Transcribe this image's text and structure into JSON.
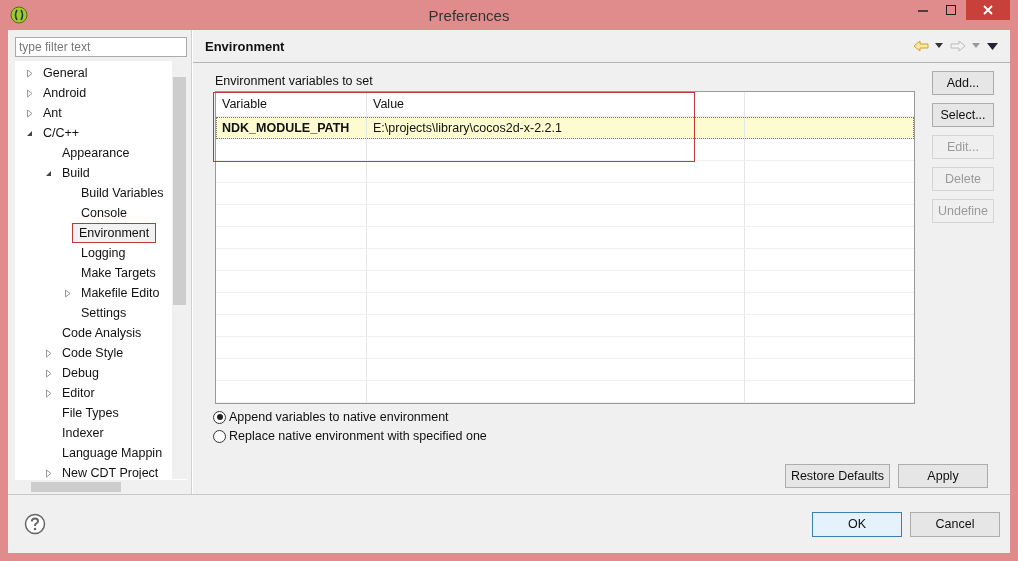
{
  "window": {
    "title": "Preferences"
  },
  "sidebar": {
    "filter": {
      "placeholder": "type filter text"
    },
    "tree": [
      {
        "label": "General",
        "kind": "folder",
        "expanded": false,
        "selected": false
      },
      {
        "label": "Android",
        "kind": "folder",
        "expanded": false,
        "selected": false
      },
      {
        "label": "Ant",
        "kind": "folder",
        "expanded": false,
        "selected": false
      },
      {
        "label": "C/C++",
        "kind": "folder",
        "expanded": true,
        "selected": false,
        "children": [
          {
            "label": "Appearance",
            "kind": "leaf",
            "selected": false
          },
          {
            "label": "Build",
            "kind": "folder",
            "expanded": true,
            "selected": false,
            "children": [
              {
                "label": "Build Variables",
                "kind": "leaf",
                "selected": false
              },
              {
                "label": "Console",
                "kind": "leaf",
                "selected": false
              },
              {
                "label": "Environment",
                "kind": "leaf",
                "selected": true
              },
              {
                "label": "Logging",
                "kind": "leaf",
                "selected": false
              },
              {
                "label": "Make Targets",
                "kind": "leaf",
                "selected": false
              },
              {
                "label": "Makefile Edito",
                "kind": "folder",
                "expanded": false,
                "selected": false
              },
              {
                "label": "Settings",
                "kind": "leaf",
                "selected": false
              }
            ]
          },
          {
            "label": "Code Analysis",
            "kind": "leaf",
            "selected": false
          },
          {
            "label": "Code Style",
            "kind": "folder",
            "expanded": false,
            "selected": false
          },
          {
            "label": "Debug",
            "kind": "folder",
            "expanded": false,
            "selected": false
          },
          {
            "label": "Editor",
            "kind": "folder",
            "expanded": false,
            "selected": false
          },
          {
            "label": "File Types",
            "kind": "leaf",
            "selected": false
          },
          {
            "label": "Indexer",
            "kind": "leaf",
            "selected": false
          },
          {
            "label": "Language Mappin",
            "kind": "leaf",
            "selected": false
          },
          {
            "label": "New CDT Project",
            "kind": "folder",
            "expanded": false,
            "selected": false
          }
        ]
      }
    ]
  },
  "page": {
    "title": "Environment",
    "table_label": "Environment variables to set",
    "table": {
      "columns": [
        "Variable",
        "Value"
      ],
      "rows": [
        {
          "variable": "NDK_MODULE_PATH",
          "value": "E:\\projects\\library\\cocos2d-x-2.2.1",
          "selected": true
        }
      ]
    },
    "side_buttons": [
      {
        "label": "Add...",
        "disabled": false
      },
      {
        "label": "Select...",
        "disabled": false
      },
      {
        "label": "Edit...",
        "disabled": true
      },
      {
        "label": "Delete",
        "disabled": true
      },
      {
        "label": "Undefine",
        "disabled": true
      }
    ],
    "options": [
      {
        "label": "Append variables to native environment",
        "selected": true
      },
      {
        "label": "Replace native environment with specified one",
        "selected": false
      }
    ],
    "page_buttons": [
      "Restore Defaults",
      "Apply"
    ]
  },
  "dialog_buttons": [
    {
      "label": "OK",
      "default": true
    },
    {
      "label": "Cancel",
      "default": false
    }
  ]
}
